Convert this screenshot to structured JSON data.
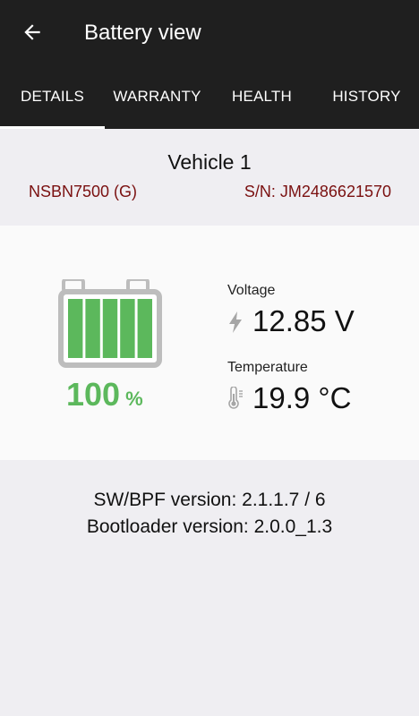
{
  "app": {
    "title": "Battery view"
  },
  "tabs": [
    {
      "label": "DETAILS",
      "active": true
    },
    {
      "label": "WARRANTY",
      "active": false
    },
    {
      "label": "HEALTH",
      "active": false
    },
    {
      "label": "HISTORY",
      "active": false
    }
  ],
  "vehicle": {
    "name": "Vehicle 1",
    "model": "NSBN7500 (G)",
    "serial": "S/N: JM2486621570"
  },
  "battery": {
    "charge_value": "100",
    "charge_unit": "%",
    "charge_level": 1.0,
    "bars_filled": 5,
    "bars_total": 5
  },
  "metrics": {
    "voltage_label": "Voltage",
    "voltage_value": "12.85 V",
    "voltage_icon": "lightning-icon",
    "temperature_label": "Temperature",
    "temperature_value": "19.9 °C",
    "temperature_icon": "thermometer-icon"
  },
  "versions": {
    "sw_bpf": "SW/BPF version: 2.1.1.7 / 6",
    "bootloader": "Bootloader version: 2.0.0_1.3"
  },
  "colors": {
    "header_bg": "#1f1f1f",
    "accent_red": "#7a1010",
    "charge_green": "#5cb85c",
    "battery_outline": "#bdbdbd"
  }
}
